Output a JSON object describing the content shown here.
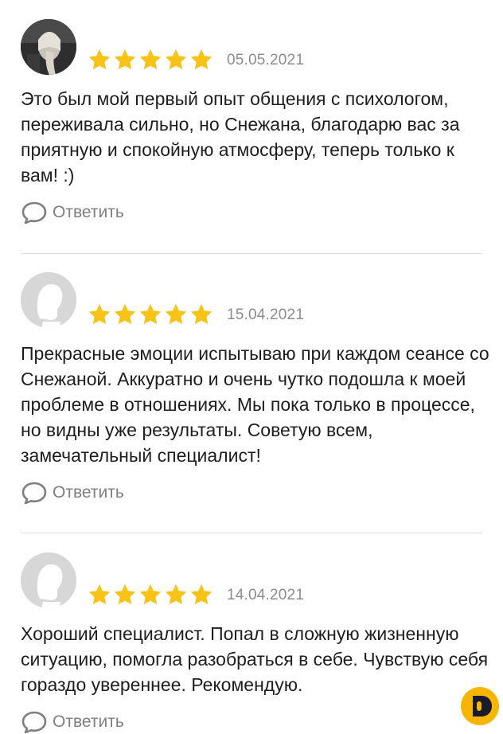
{
  "colors": {
    "star": "#f7c316",
    "reply": "#7f7f7f",
    "date": "#8c8c8c",
    "logo_accent": "#f7b500"
  },
  "reviews": [
    {
      "rating": 5,
      "date": "05.05.2021",
      "avatar": "user-photo",
      "text": "Это был мой первый опыт общения с психологом, переживала сильно, но Снежана, благодарю вас за приятную и спокойную атмосферу, теперь только к вам! :)",
      "reply_label": "Ответить"
    },
    {
      "rating": 5,
      "date": "15.04.2021",
      "avatar": "default-avatar",
      "text": "Прекрасные эмоции испытываю при каждом сеансе со Снежаной. Аккуратно и очень чутко подошла к моей проблеме в отношениях. Мы пока только в процессе, но видны уже результаты. Советую всем, замечательный специалист!",
      "reply_label": "Ответить"
    },
    {
      "rating": 5,
      "date": "14.04.2021",
      "avatar": "default-avatar",
      "text": "Хороший специалист. Попал в сложную жизненную ситуацию, помогла разобраться в себе. Чувствую себя гораздо увереннее. Рекомендую.",
      "reply_label": "Ответить"
    }
  ]
}
